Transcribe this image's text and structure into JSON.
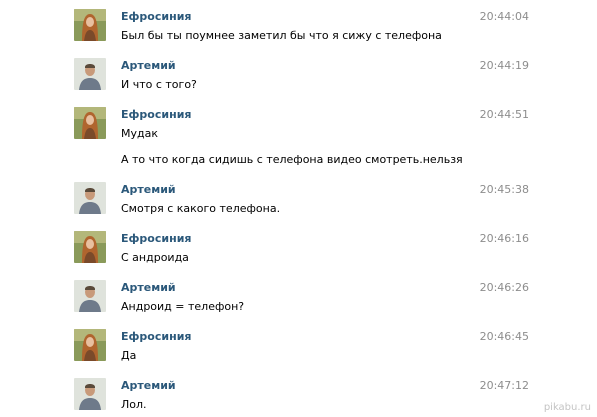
{
  "messages": [
    {
      "author": "Ефросиния",
      "avatar": "female-avatar",
      "time": "20:44:04",
      "lines": [
        "Был бы ты поумнее заметил бы что я сижу с телефона"
      ]
    },
    {
      "author": "Артемий",
      "avatar": "male-avatar",
      "time": "20:44:19",
      "lines": [
        "И что с того?"
      ]
    },
    {
      "author": "Ефросиния",
      "avatar": "female-avatar",
      "time": "20:44:51",
      "lines": [
        "Мудак",
        "А то что когда сидишь с телефона видео смотреть.нельзя"
      ]
    },
    {
      "author": "Артемий",
      "avatar": "male-avatar",
      "time": "20:45:38",
      "lines": [
        "Смотря с какого телефона."
      ]
    },
    {
      "author": "Ефросиния",
      "avatar": "female-avatar",
      "time": "20:46:16",
      "lines": [
        "С андроида"
      ]
    },
    {
      "author": "Артемий",
      "avatar": "male-avatar",
      "time": "20:46:26",
      "lines": [
        "Андроид = телефон?"
      ]
    },
    {
      "author": "Ефросиния",
      "avatar": "female-avatar",
      "time": "20:46:45",
      "lines": [
        "Да"
      ]
    },
    {
      "author": "Артемий",
      "avatar": "male-avatar",
      "time": "20:47:12",
      "lines": [
        "Лол."
      ]
    }
  ],
  "watermark": "pikabu.ru",
  "colors": {
    "author": "#2b587a",
    "time": "#8d8d8d"
  }
}
